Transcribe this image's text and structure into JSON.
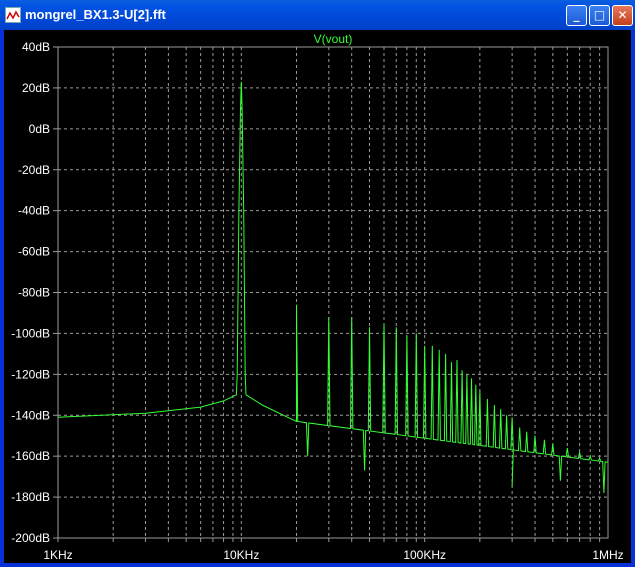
{
  "window": {
    "title": "mongrel_BX1.3-U[2].fft",
    "minimize_label": "_",
    "maximize_label": "□",
    "close_label": "✕"
  },
  "colors": {
    "trace": "#33ff33",
    "grid": "#9a9a9a",
    "background": "#000000",
    "axis_text": "#ffffff"
  },
  "chart_data": {
    "type": "line",
    "title": "V(vout)",
    "xscale": "log",
    "xlim": [
      1000,
      1000000
    ],
    "ylim": [
      -200,
      40
    ],
    "x_tick_labels": [
      "1KHz",
      "10KHz",
      "100KHz",
      "1MHz"
    ],
    "y_tick_labels": [
      "40dB",
      "20dB",
      "0dB",
      "-20dB",
      "-40dB",
      "-60dB",
      "-80dB",
      "-100dB",
      "-120dB",
      "-140dB",
      "-160dB",
      "-180dB",
      "-200dB"
    ],
    "grid": true,
    "series": [
      {
        "name": "V(vout)",
        "fundamental": {
          "x": 10000,
          "y": 23
        },
        "baseline": [
          [
            1000,
            -141
          ],
          [
            3000,
            -139
          ],
          [
            6000,
            -136
          ],
          [
            8000,
            -133
          ],
          [
            9400,
            -130
          ],
          [
            10600,
            -130
          ],
          [
            13000,
            -135
          ],
          [
            17000,
            -140
          ],
          [
            20000,
            -143
          ]
        ],
        "harmonics": [
          [
            20000,
            -86
          ],
          [
            30000,
            -92
          ],
          [
            40000,
            -92
          ],
          [
            50000,
            -97
          ],
          [
            60000,
            -95
          ],
          [
            70000,
            -97
          ],
          [
            80000,
            -101
          ],
          [
            90000,
            -100
          ],
          [
            100000,
            -106
          ],
          [
            110000,
            -106
          ],
          [
            120000,
            -108
          ],
          [
            130000,
            -110
          ],
          [
            140000,
            -114
          ],
          [
            150000,
            -113
          ],
          [
            160000,
            -118
          ],
          [
            170000,
            -120
          ],
          [
            180000,
            -122
          ],
          [
            190000,
            -125
          ],
          [
            200000,
            -128
          ],
          [
            220000,
            -132
          ],
          [
            240000,
            -135
          ],
          [
            260000,
            -137
          ],
          [
            280000,
            -140
          ],
          [
            300000,
            -141
          ],
          [
            330000,
            -146
          ],
          [
            360000,
            -148
          ],
          [
            400000,
            -150
          ],
          [
            450000,
            -152
          ],
          [
            500000,
            -154
          ],
          [
            600000,
            -156
          ],
          [
            700000,
            -158
          ],
          [
            800000,
            -160
          ],
          [
            900000,
            -161
          ]
        ],
        "notches": [
          [
            23000,
            -160
          ],
          [
            47000,
            -167
          ],
          [
            300000,
            -175
          ],
          [
            550000,
            -172
          ],
          [
            950000,
            -178
          ]
        ]
      }
    ]
  }
}
